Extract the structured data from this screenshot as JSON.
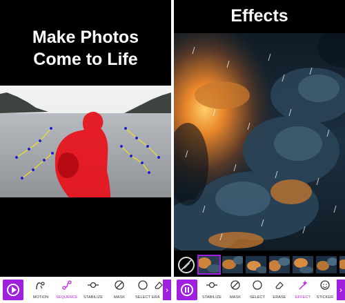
{
  "left_screen": {
    "headline_line1": "Make Photos",
    "headline_line2": "Come to Life",
    "toolbar": {
      "play_icon": "play-circle-icon",
      "tools": [
        {
          "label": "MOTION",
          "icon": "motion-icon",
          "active": false
        },
        {
          "label": "SEQUENCE",
          "icon": "sequence-icon",
          "active": true
        },
        {
          "label": "STABILIZE",
          "icon": "stabilize-icon",
          "active": false
        },
        {
          "label": "MASK",
          "icon": "mask-icon",
          "active": false
        },
        {
          "label": "SELECT",
          "icon": "select-icon",
          "active": false
        },
        {
          "label": "ERA",
          "icon": "erase-icon",
          "active": false
        }
      ]
    }
  },
  "right_screen": {
    "headline": "Effects",
    "filmstrip": {
      "no_effect_icon": "no-effect-icon",
      "thumbnails": 7,
      "selected_index": 0
    },
    "toolbar": {
      "pause_icon": "pause-circle-icon",
      "tools": [
        {
          "label": "STABILIZE",
          "icon": "stabilize-icon",
          "active": false
        },
        {
          "label": "MASK",
          "icon": "mask-icon",
          "active": false
        },
        {
          "label": "SELECT",
          "icon": "select-icon",
          "active": false
        },
        {
          "label": "ERASE",
          "icon": "erase-icon",
          "active": false
        },
        {
          "label": "EFFECT",
          "icon": "effect-icon",
          "active": true
        },
        {
          "label": "STICKER",
          "icon": "sticker-icon",
          "active": false
        }
      ]
    }
  },
  "colors": {
    "accent": "#a020e0",
    "active_label": "#c020e0",
    "mask_red": "#e8101a",
    "background": "#000000"
  }
}
